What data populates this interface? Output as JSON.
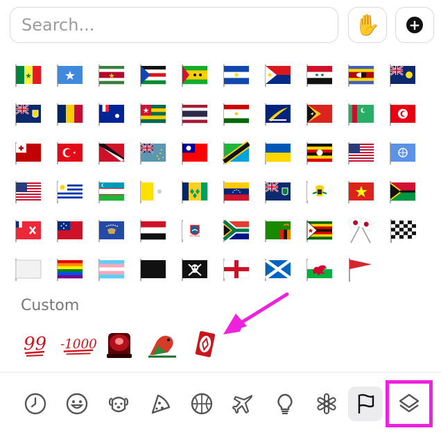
{
  "search": {
    "placeholder": "Search..."
  },
  "toolbar": {
    "skin_tone_emoji": "✋",
    "add_label": "+"
  },
  "flags": {
    "rows": [
      [
        "senegal",
        "somalia",
        "suriname",
        "south-sudan",
        "sao-tome",
        "el-salvador",
        "sint-maarten",
        "syria",
        "eswatini",
        "turks-caicos"
      ],
      [
        "british-virgin-alt",
        "chad",
        "french-southern",
        "togo",
        "thailand",
        "tajikistan",
        "tokelau",
        "timor-leste",
        "turkmenistan",
        "tunisia"
      ],
      [
        "tonga",
        "turkey",
        "trinidad",
        "tuvalu",
        "taiwan",
        "tanzania",
        "ukraine",
        "uganda",
        "us-outlying",
        "united-nations"
      ],
      [
        "usa",
        "uruguay",
        "uzbekistan",
        "vatican",
        "st-vincent",
        "venezuela",
        "british-virgin",
        "us-virgin",
        "vietnam",
        "vanuatu"
      ],
      [
        "wallis-futuna",
        "samoa",
        "kosovo",
        "yemen",
        "mayotte",
        "south-africa",
        "zambia",
        "zimbabwe",
        "crossed-flags",
        "checkered-flag"
      ],
      [
        "white-flag",
        "rainbow-flag",
        "transgender-flag",
        "black-flag",
        "pirate-flag",
        "england",
        "scotland",
        "wales",
        "triangular-flag"
      ]
    ]
  },
  "custom": {
    "label": "Custom",
    "items": [
      "99",
      "-1000",
      "siren",
      "parrot",
      "uno-reverse"
    ]
  },
  "categories": [
    "recent-clock",
    "smileys",
    "animals",
    "food",
    "activity",
    "travel",
    "objects",
    "symbols",
    "flags",
    "custom-stack"
  ],
  "colors": {
    "accent": "#ee22dd",
    "border": "#d9d9dc",
    "label": "#76767b"
  }
}
